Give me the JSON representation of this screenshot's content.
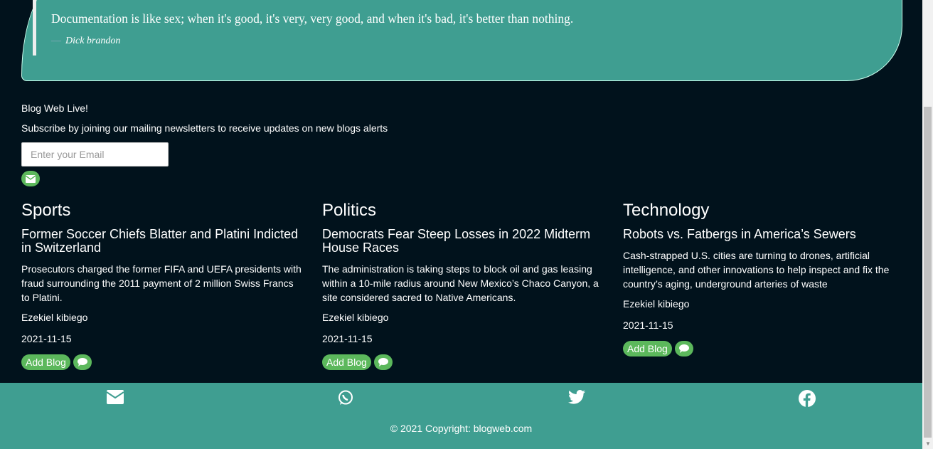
{
  "quote": {
    "text": "Documentation is like sex; when it's good, it's very, very good, and when it's bad, it's better than nothing.",
    "dash": "—",
    "author": "Dick brandon"
  },
  "newsletter": {
    "title": "Blog Web Live!",
    "subtitle": "Subscribe by joining our mailing newsletters to receive updates on new blogs alerts",
    "placeholder": "Enter your Email"
  },
  "columns": [
    {
      "category": "Sports",
      "title": "Former Soccer Chiefs Blatter and Platini Indicted in Switzerland",
      "summary": "Prosecutors charged the former FIFA and UEFA presidents with fraud surrounding the 2011 payment of 2 million Swiss Francs to Platini.",
      "author": "Ezekiel kibiego",
      "date": "2021-11-15",
      "add_label": "Add Blog"
    },
    {
      "category": "Politics",
      "title": "Democrats Fear Steep Losses in 2022 Midterm House Races",
      "summary": "The administration is taking steps to block oil and gas leasing within a 10-mile radius around New Mexico’s Chaco Canyon, a site considered sacred to Native Americans.",
      "author": "Ezekiel kibiego",
      "date": "2021-11-15",
      "add_label": "Add Blog"
    },
    {
      "category": "Technology",
      "title": "Robots vs. Fatbergs in America’s Sewers",
      "summary": "Cash-strapped U.S. cities are turning to drones, artificial intelligence, and other innovations to help inspect and fix the country’s aging, underground arteries of waste",
      "author": "Ezekiel kibiego",
      "date": "2021-11-15",
      "add_label": "Add Blog"
    }
  ],
  "footer": {
    "icons": [
      "envelope-icon",
      "whatsapp-icon",
      "twitter-icon",
      "facebook-icon"
    ],
    "copyright": "© 2021 Copyright: blogweb.com"
  },
  "colors": {
    "background": "#01121c",
    "teal": "#3f9e91",
    "green": "#5cb85c"
  }
}
